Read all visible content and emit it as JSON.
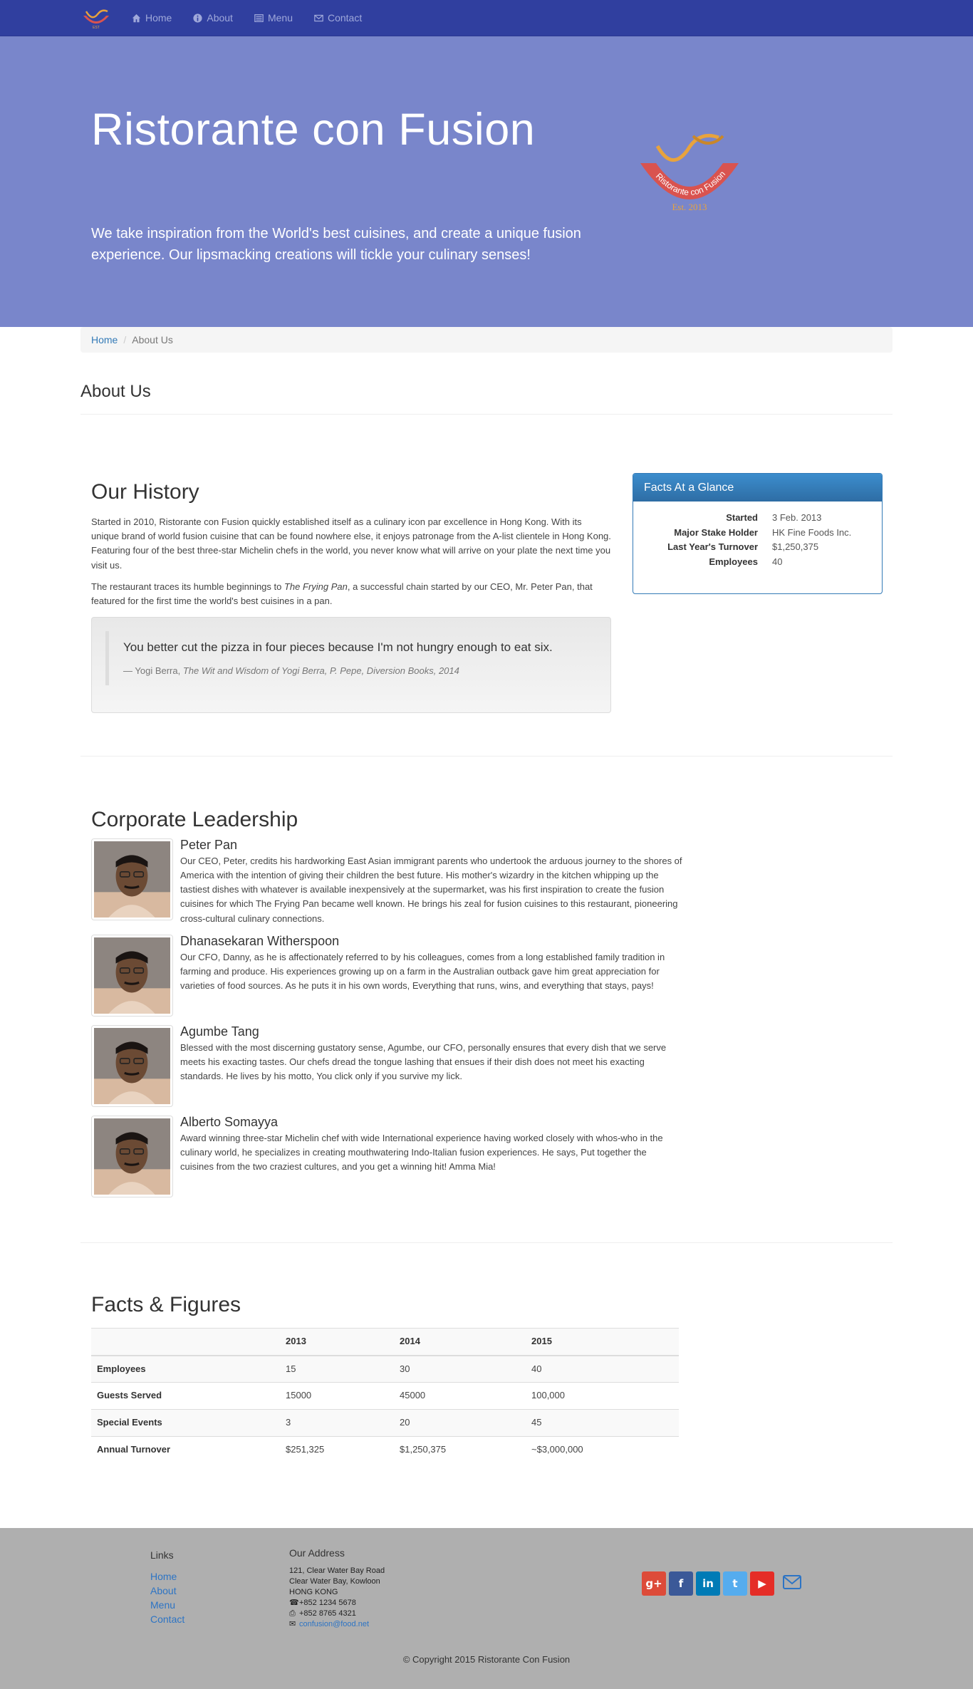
{
  "navbar": {
    "brand_icon": "restaurant-logo",
    "items": [
      {
        "label": "Home",
        "icon": "home-icon"
      },
      {
        "label": "About",
        "icon": "info-icon"
      },
      {
        "label": "Menu",
        "icon": "list-icon"
      },
      {
        "label": "Contact",
        "icon": "envelope-icon"
      }
    ]
  },
  "jumbotron": {
    "title": "Ristorante con Fusion",
    "tagline": "We take inspiration from the World's best cuisines, and create a unique fusion experience. Our lipsmacking creations will tickle your culinary senses!",
    "logo_text": "Ristorante con Fusion",
    "logo_est": "Est. 2013"
  },
  "breadcrumb": {
    "home": "Home",
    "separator": "/",
    "current": "About Us"
  },
  "page_title": "About Us",
  "history": {
    "heading": "Our History",
    "para1": "Started in 2010, Ristorante con Fusion quickly established itself as a culinary icon par excellence in Hong Kong. With its unique brand of world fusion cuisine that can be found nowhere else, it enjoys patronage from the A-list clientele in Hong Kong. Featuring four of the best three-star Michelin chefs in the world, you never know what will arrive on your plate the next time you visit us.",
    "para2_pre": "The restaurant traces its humble beginnings to ",
    "para2_em": "The Frying Pan",
    "para2_post": ", a successful chain started by our CEO, Mr. Peter Pan, that featured for the first time the world's best cuisines in a pan.",
    "quote": "You better cut the pizza in four pieces because I'm not hungry enough to eat six.",
    "quote_author": "— Yogi Berra, ",
    "quote_source": "The Wit and Wisdom of Yogi Berra, P. Pepe, Diversion Books, 2014"
  },
  "facts_panel": {
    "title": "Facts At a Glance",
    "rows": [
      {
        "label": "Started",
        "value": "3 Feb. 2013"
      },
      {
        "label": "Major Stake Holder",
        "value": "HK Fine Foods Inc."
      },
      {
        "label": "Last Year's Turnover",
        "value": "$1,250,375"
      },
      {
        "label": "Employees",
        "value": "40"
      }
    ]
  },
  "leadership": {
    "heading": "Corporate Leadership",
    "people": [
      {
        "name": "Peter Pan",
        "bio": "Our CEO, Peter, credits his hardworking East Asian immigrant parents who undertook the arduous journey to the shores of America with the intention of giving their children the best future. His mother's wizardry in the kitchen whipping up the tastiest dishes with whatever is available inexpensively at the supermarket, was his first inspiration to create the fusion cuisines for which The Frying Pan became well known. He brings his zeal for fusion cuisines to this restaurant, pioneering cross-cultural culinary connections."
      },
      {
        "name": "Dhanasekaran Witherspoon",
        "bio": "Our CFO, Danny, as he is affectionately referred to by his colleagues, comes from a long established family tradition in farming and produce. His experiences growing up on a farm in the Australian outback gave him great appreciation for varieties of food sources. As he puts it in his own words, Everything that runs, wins, and everything that stays, pays!"
      },
      {
        "name": "Agumbe Tang",
        "bio": "Blessed with the most discerning gustatory sense, Agumbe, our CFO, personally ensures that every dish that we serve meets his exacting tastes. Our chefs dread the tongue lashing that ensues if their dish does not meet his exacting standards. He lives by his motto, You click only if you survive my lick."
      },
      {
        "name": "Alberto Somayya",
        "bio": "Award winning three-star Michelin chef with wide International experience having worked closely with whos-who in the culinary world, he specializes in creating mouthwatering Indo-Italian fusion experiences. He says, Put together the cuisines from the two craziest cultures, and you get a winning hit! Amma Mia!"
      }
    ]
  },
  "facts_figures": {
    "heading": "Facts & Figures",
    "columns": [
      "",
      "2013",
      "2014",
      "2015"
    ],
    "rows": [
      [
        "Employees",
        "15",
        "30",
        "40"
      ],
      [
        "Guests Served",
        "15000",
        "45000",
        "100,000"
      ],
      [
        "Special Events",
        "3",
        "20",
        "45"
      ],
      [
        "Annual Turnover",
        "$251,325",
        "$1,250,375",
        "~$3,000,000"
      ]
    ]
  },
  "footer": {
    "links_heading": "Links",
    "links": [
      "Home",
      "About",
      "Menu",
      "Contact"
    ],
    "address_heading": "Our Address",
    "address_lines": [
      "121, Clear Water Bay Road",
      "Clear Water Bay, Kowloon",
      "HONG KONG"
    ],
    "phone": "+852 1234 5678",
    "fax": "+852 8765 4321",
    "email": "confusion@food.net",
    "social": [
      {
        "icon": "google-plus-icon",
        "glyph": "g+",
        "color": "#dd4b39"
      },
      {
        "icon": "facebook-icon",
        "glyph": "f",
        "color": "#3b5998"
      },
      {
        "icon": "linkedin-icon",
        "glyph": "in",
        "color": "#007bb6"
      },
      {
        "icon": "twitter-icon",
        "glyph": "t",
        "color": "#55acee"
      },
      {
        "icon": "youtube-icon",
        "glyph": "▶",
        "color": "#e52d27"
      }
    ],
    "copyright": "© Copyright 2015 Ristorante Con Fusion"
  }
}
